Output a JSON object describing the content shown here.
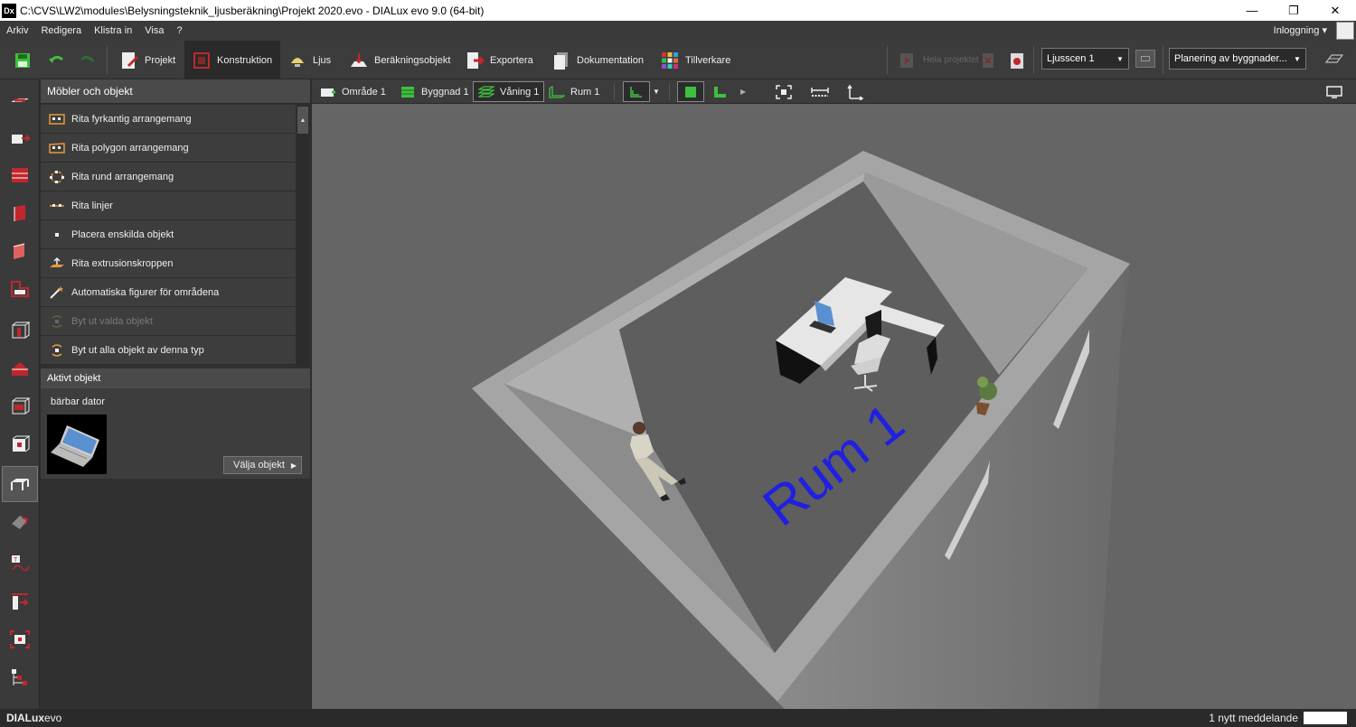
{
  "window": {
    "app_icon": "Dx",
    "title": "C:\\CVS\\LW2\\modules\\Belysningsteknik_ljusberäkning\\Projekt 2020.evo - DIALux evo 9.0  (64-bit)",
    "controls": [
      "minimize-icon",
      "restore-icon",
      "close-icon"
    ]
  },
  "menu": {
    "items": [
      "Arkiv",
      "Redigera",
      "Klistra in",
      "Visa",
      "?"
    ],
    "login": "Inloggning"
  },
  "toolbar": {
    "tabs": [
      {
        "label": "Projekt",
        "icon": "project-icon"
      },
      {
        "label": "Konstruktion",
        "icon": "construction-icon"
      },
      {
        "label": "Ljus",
        "icon": "light-icon"
      },
      {
        "label": "Beräkningsobjekt",
        "icon": "calc-object-icon"
      },
      {
        "label": "Exportera",
        "icon": "export-icon"
      },
      {
        "label": "Dokumentation",
        "icon": "documentation-icon"
      },
      {
        "label": "Tillverkare",
        "icon": "manufacturer-icon"
      }
    ],
    "active_tab": "Konstruktion",
    "whole_project": "Hela projektet",
    "light_scene": "Ljusscen 1",
    "planning_mode": "Planering av byggnader..."
  },
  "left_panel": {
    "header": "Möbler och objekt",
    "items": [
      {
        "label": "Rita fyrkantig arrangemang",
        "icon": "rect-arrangement-icon",
        "enabled": true
      },
      {
        "label": "Rita polygon arrangemang",
        "icon": "polygon-arrangement-icon",
        "enabled": true
      },
      {
        "label": "Rita rund arrangemang",
        "icon": "round-arrangement-icon",
        "enabled": true
      },
      {
        "label": "Rita linjer",
        "icon": "line-arrangement-icon",
        "enabled": true
      },
      {
        "label": "Placera enskilda objekt",
        "icon": "single-object-icon",
        "enabled": true
      },
      {
        "label": "Rita extrusionskroppen",
        "icon": "extrusion-icon",
        "enabled": true
      },
      {
        "label": "Automatiska figurer för områdena",
        "icon": "magic-wand-icon",
        "enabled": true
      },
      {
        "label": "Byt ut valda objekt",
        "icon": "replace-selected-icon",
        "enabled": false
      },
      {
        "label": "Byt ut alla objekt av denna typ",
        "icon": "replace-all-icon",
        "enabled": true
      }
    ],
    "active_object": {
      "header": "Aktivt objekt",
      "name": "bärbar dator",
      "choose_button": "Välja objekt"
    }
  },
  "view_toolbar": {
    "breadcrumbs": [
      "Område 1",
      "Byggnad 1",
      "Våning 1",
      "Rum 1"
    ],
    "selected": "Våning 1"
  },
  "viewport": {
    "room_label": "Rum 1",
    "room_label_color": "#2020e0"
  },
  "status": {
    "brand_a": "DIALux",
    "brand_b": "evo",
    "message": "1 nytt meddelande"
  },
  "colors": {
    "accent_red": "#c0272d",
    "active_green": "#3fbf3f"
  }
}
